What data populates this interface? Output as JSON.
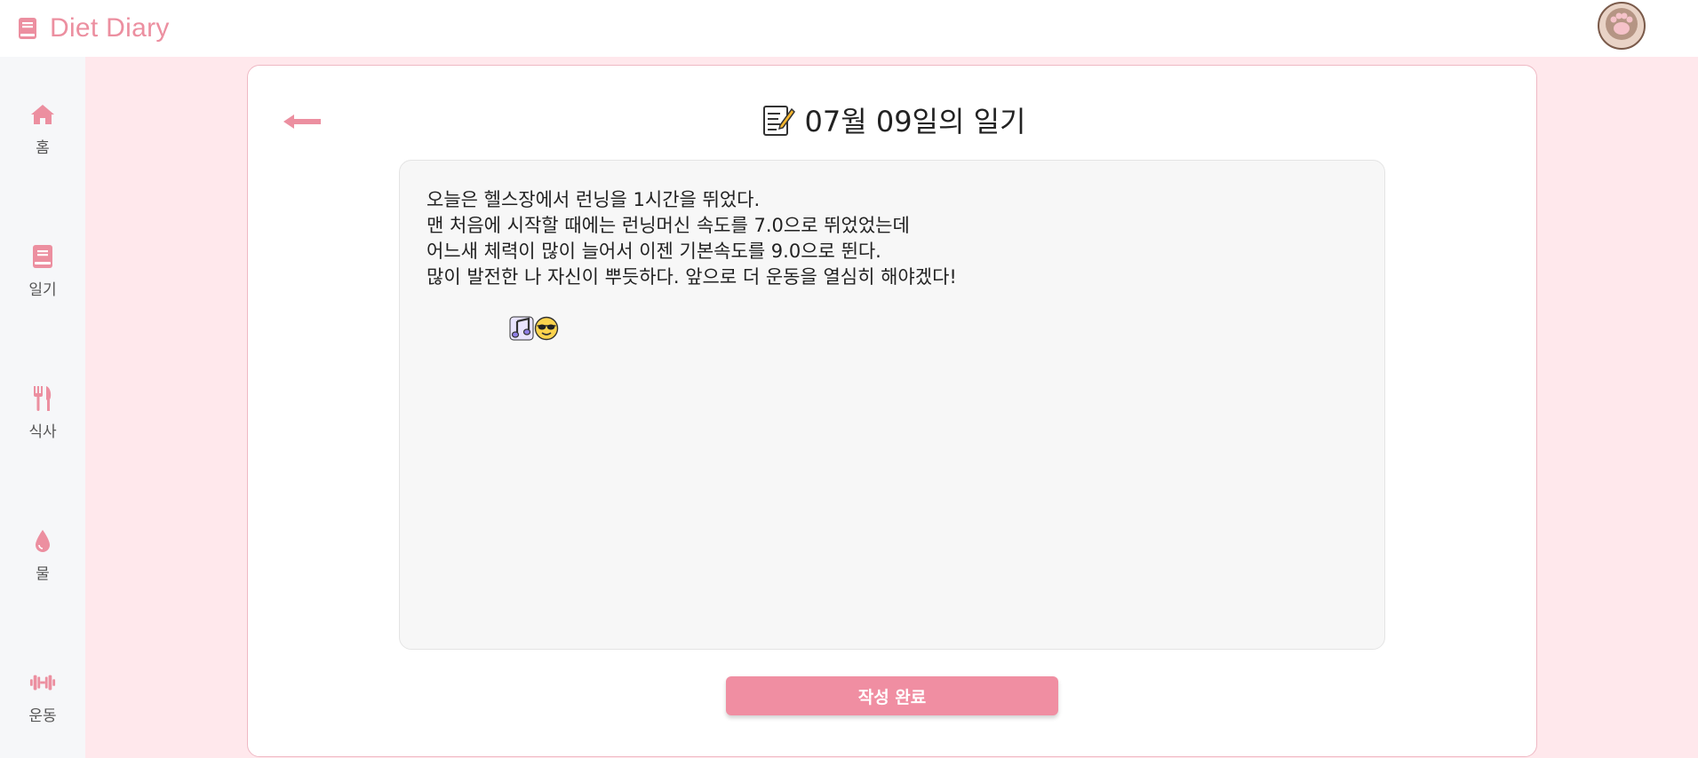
{
  "app": {
    "title": "Diet Diary",
    "accent_color": "#ec8fa0",
    "brand_icon": "book-icon",
    "avatar_icon": "paw-icon"
  },
  "sidebar": {
    "items": [
      {
        "label": "홈",
        "icon": "home-icon"
      },
      {
        "label": "일기",
        "icon": "book-icon"
      },
      {
        "label": "식사",
        "icon": "utensils-icon"
      },
      {
        "label": "물",
        "icon": "droplet-icon"
      },
      {
        "label": "운동",
        "icon": "dumbbell-icon"
      }
    ]
  },
  "page": {
    "title": "07월 09일의 일기",
    "title_icon": "memo-icon",
    "back_icon": "arrow-left-icon"
  },
  "diary": {
    "lines": [
      "오늘은 헬스장에서 런닝을 1시간을 뛰었다.",
      "맨 처음에 시작할 때에는 런닝머신 속도를 7.0으로 뛰었었는데",
      "어느새 체력이 많이 늘어서 이젠 기본속도를 9.0으로 뛴다.",
      "많이 발전한 나 자신이 뿌듯하다. 앞으로 더 운동을 열심히 해야겠다!"
    ],
    "trailing_icons": [
      "music-notes-icon",
      "sunglasses-face-icon"
    ]
  },
  "actions": {
    "submit_label": "작성 완료"
  }
}
